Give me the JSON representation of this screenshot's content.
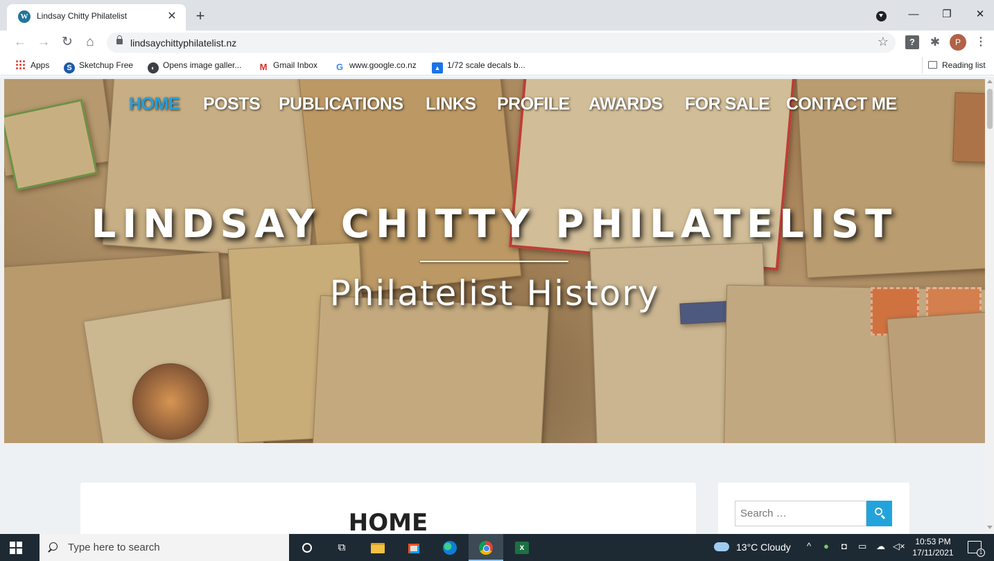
{
  "browser": {
    "tab": {
      "title": "Lindsay Chitty Philatelist",
      "favicon": "wordpress-icon"
    },
    "url": "lindsaychittyphilatelist.nz",
    "profile_initial": "P",
    "bookmarks": [
      {
        "label": "Apps",
        "icon": "apps-grid-icon"
      },
      {
        "label": "Sketchup Free",
        "icon": "sketchup-icon"
      },
      {
        "label": "Opens image galler...",
        "icon": "gallery-icon"
      },
      {
        "label": "Gmail Inbox",
        "icon": "gmail-icon"
      },
      {
        "label": "www.google.co.nz",
        "icon": "google-icon"
      },
      {
        "label": "1/72 scale decals b...",
        "icon": "decals-icon"
      }
    ],
    "reading_list": "Reading list"
  },
  "site": {
    "menu": [
      {
        "label": "HOME",
        "active": true
      },
      {
        "label": "POSTS"
      },
      {
        "label": "PUBLICATIONS"
      },
      {
        "label": "LINKS"
      },
      {
        "label": "PROFILE"
      },
      {
        "label": "AWARDS"
      },
      {
        "label": "FOR SALE"
      },
      {
        "label": "CONTACT ME"
      }
    ],
    "title": "LINDSAY CHITTY PHILATELIST",
    "tagline": "Philatelist History",
    "page_heading": "HOME",
    "search_placeholder": "Search …",
    "colors": {
      "accent": "#2a9fd6",
      "search_button": "#23a3dc"
    }
  },
  "taskbar": {
    "search_placeholder": "Type here to search",
    "weather": "13°C  Cloudy",
    "time": "10:53 PM",
    "date": "17/11/2021",
    "notification_count": "1"
  }
}
